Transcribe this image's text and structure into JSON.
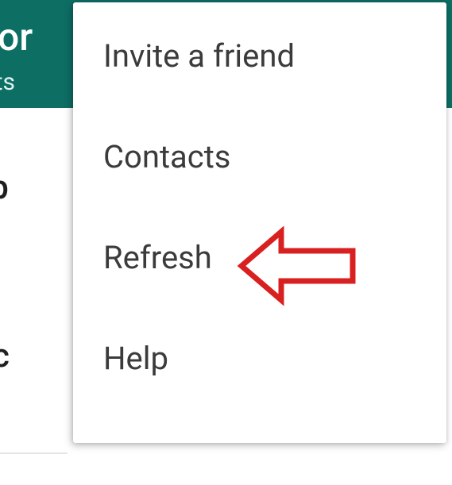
{
  "header": {
    "title_fragment": "t cor",
    "subtitle_fragment": "cts"
  },
  "background": {
    "item1_fragment": "oup",
    "item2_fragment": "ntac"
  },
  "menu": {
    "items": [
      {
        "label": "Invite a friend"
      },
      {
        "label": "Contacts"
      },
      {
        "label": "Refresh"
      },
      {
        "label": "Help"
      }
    ]
  },
  "annotation": {
    "target": "Refresh",
    "color": "#d92020"
  }
}
